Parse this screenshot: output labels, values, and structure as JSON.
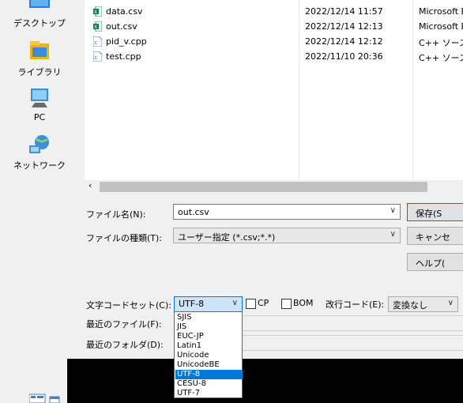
{
  "sidebar": {
    "items": [
      {
        "label": "デスクトップ",
        "icon": "desktop-icon"
      },
      {
        "label": "ライブラリ",
        "icon": "library-icon"
      },
      {
        "label": "PC",
        "icon": "pc-icon"
      },
      {
        "label": "ネットワーク",
        "icon": "network-icon"
      }
    ]
  },
  "files": [
    {
      "name": "data.csv",
      "date": "2022/12/14 11:57",
      "type": "Microsoft E",
      "icon": "excel-csv-icon"
    },
    {
      "name": "out.csv",
      "date": "2022/12/14 12:13",
      "type": "Microsoft E",
      "icon": "excel-csv-icon"
    },
    {
      "name": "pid_v.cpp",
      "date": "2022/12/14 12:12",
      "type": "C++ ソース",
      "icon": "cpp-file-icon"
    },
    {
      "name": "test.cpp",
      "date": "2022/11/10 20:36",
      "type": "C++ ソース",
      "icon": "cpp-file-icon"
    }
  ],
  "form": {
    "filename_label": "ファイル名(N):",
    "filename_value": "out.csv",
    "filetype_label": "ファイルの種類(T):",
    "filetype_value": "ユーザー指定 (*.csv;*.*)",
    "charset_label": "文字コードセット(C):",
    "charset_value": "UTF-8",
    "cp_label": "CP",
    "bom_label": "BOM",
    "newline_label": "改行コード(E):",
    "newline_value": "変換なし",
    "recent_file_label": "最近のファイル(F):",
    "recent_folder_label": "最近のフォルダ(D):"
  },
  "buttons": {
    "save": "保存(S",
    "cancel": "キャンセ",
    "help": "ヘルプ("
  },
  "charset_options": [
    "SJIS",
    "JIS",
    "EUC-JP",
    "Latin1",
    "Unicode",
    "UnicodeBE",
    "UTF-8",
    "CESU-8",
    "UTF-7"
  ],
  "charset_selected_index": 6,
  "colors": {
    "selection": "#0078d7",
    "window_bg": "#f0f0f0"
  }
}
